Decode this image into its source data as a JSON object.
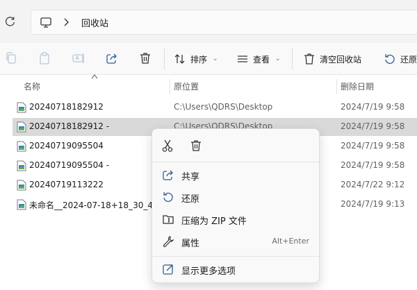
{
  "address": {
    "refresh_icon": "refresh-icon",
    "computer_icon": "monitor-icon",
    "separator_icon": "chevron-right-icon",
    "path": "回收站"
  },
  "toolbar": {
    "sort_label": "排序",
    "view_label": "查看",
    "empty_bin_label": "清空回收站",
    "restore_label": "还原"
  },
  "columns": {
    "name": "名称",
    "original_location": "原位置",
    "date_deleted": "删除日期"
  },
  "files": [
    {
      "name": "20240718182912",
      "location": "C:\\Users\\QDRS\\Desktop",
      "deleted": "2024/7/19 9:58"
    },
    {
      "name": "20240718182912 -",
      "location": "C:\\Users\\QDRS\\Desktop",
      "deleted": "2024/7/19 9:58"
    },
    {
      "name": "20240719095504",
      "location": "",
      "deleted": "2024/7/19 9:58"
    },
    {
      "name": "20240719095504 -",
      "location": "",
      "deleted": "2024/7/19 9:58"
    },
    {
      "name": "20240719113222",
      "location": "",
      "deleted": "2024/7/22 9:12"
    },
    {
      "name": "未命名__2024-07-18+18_30_49",
      "location": "",
      "deleted": "2024/7/19 9:13"
    }
  ],
  "context_menu": {
    "quick_actions": [
      "cut-icon",
      "delete-icon"
    ],
    "items": [
      {
        "label": "共享",
        "icon": "share-icon",
        "shortcut": ""
      },
      {
        "label": "还原",
        "icon": "restore-icon",
        "shortcut": ""
      },
      {
        "label": "压缩为 ZIP 文件",
        "icon": "zip-icon",
        "shortcut": ""
      },
      {
        "label": "属性",
        "icon": "wrench-icon",
        "shortcut": "Alt+Enter"
      },
      {
        "label": "显示更多选项",
        "icon": "more-options-icon",
        "shortcut": ""
      }
    ]
  },
  "colors": {
    "selection": "#d9d9d9",
    "menu_bg": "#f9f9f9",
    "file_icon_accent": "#2e8bc0"
  }
}
